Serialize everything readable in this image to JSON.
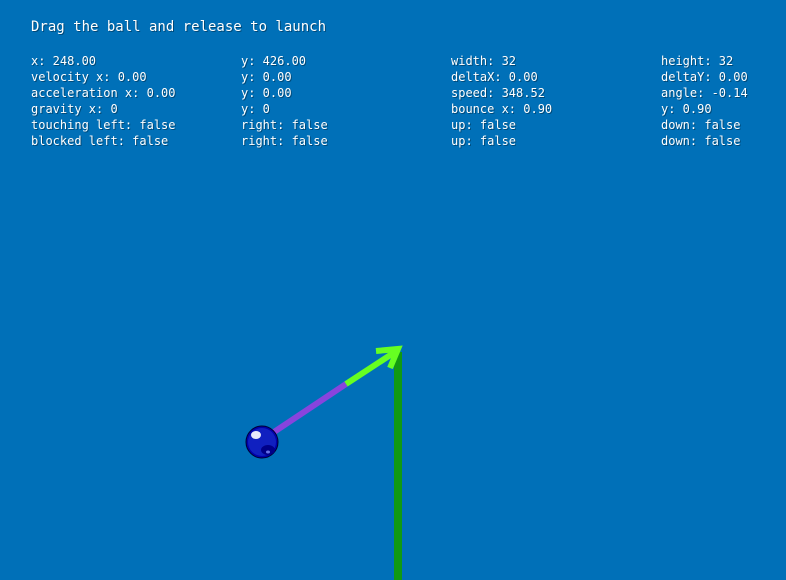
{
  "instruction": "Drag the ball and release to launch",
  "debug": {
    "col1": [
      "x: 248.00",
      "velocity x: 0.00",
      "acceleration x: 0.00",
      "gravity x: 0",
      "touching left: false",
      "blocked left: false"
    ],
    "col2": [
      "y: 426.00",
      "y: 0.00",
      "y: 0.00",
      "y: 0",
      "right: false",
      "right: false"
    ],
    "col3": [
      "width: 32",
      "deltaX: 0.00",
      "speed: 348.52",
      "bounce x: 0.90",
      "up: false",
      "up: false"
    ],
    "col4": [
      "height: 32",
      "deltaY: 0.00",
      "angle: -0.14",
      "y: 0.90",
      "down: false",
      "down: false"
    ]
  },
  "colors": {
    "background": "#0070b8",
    "drag_line": "#8844dd",
    "arrow": "#66ff22",
    "vertical_line": "#119911",
    "ball": "#0000aa"
  }
}
